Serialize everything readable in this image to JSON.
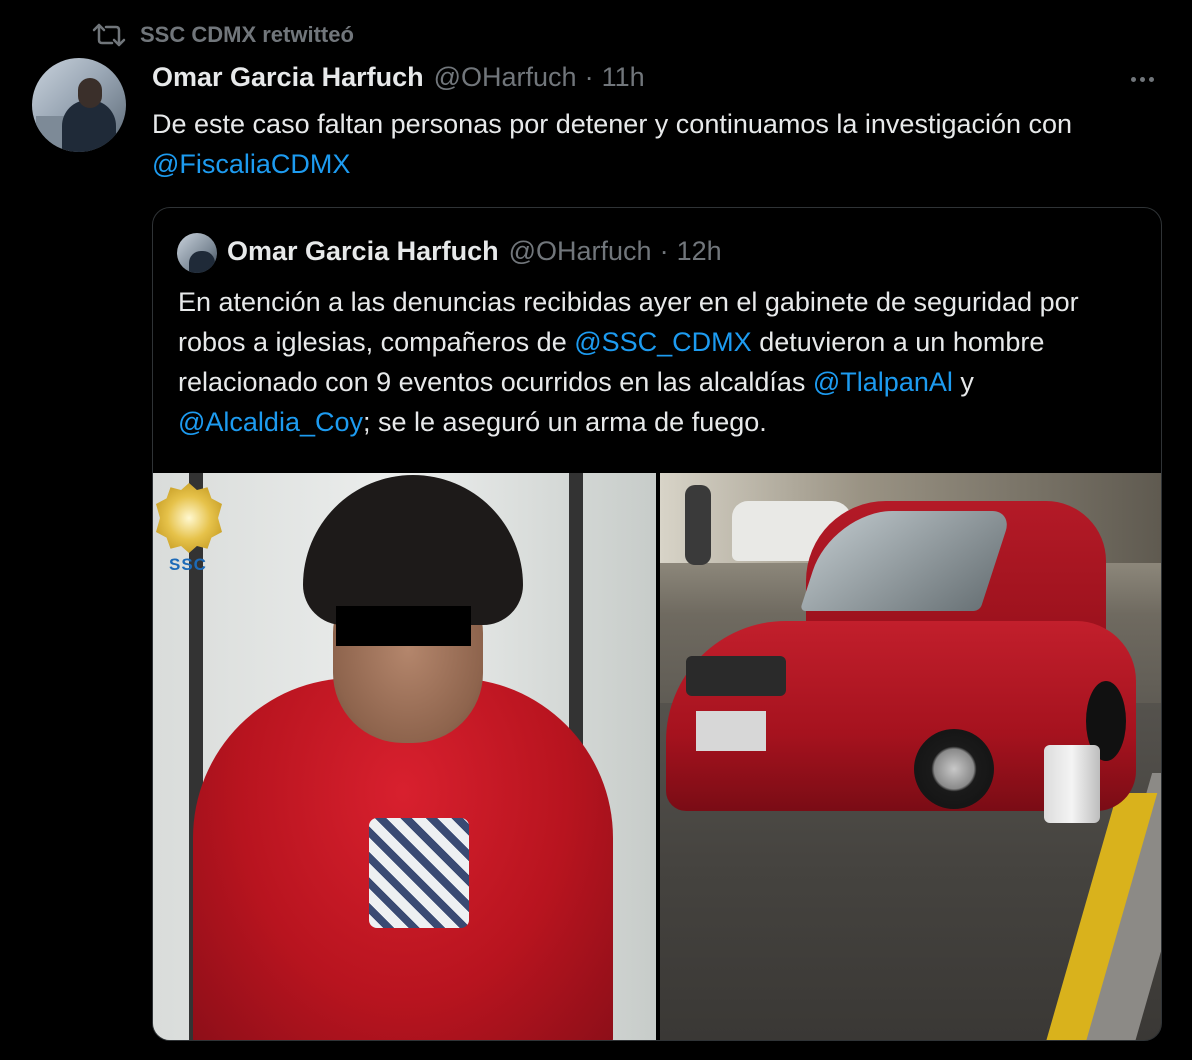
{
  "retweet": {
    "label": "SSC CDMX retwitteó",
    "icon": "retweet-icon"
  },
  "tweet": {
    "author_name": "Omar Garcia Harfuch",
    "handle": "@OHarfuch",
    "separator": "·",
    "time": "11h",
    "text_before": "De este caso faltan personas por detener y continuamos la investigación con ",
    "mention": "@FiscaliaCDMX",
    "more_icon": "more-icon"
  },
  "quote": {
    "author_name": "Omar Garcia Harfuch",
    "handle": "@OHarfuch",
    "separator": "·",
    "time": "12h",
    "text_part1": "En atención a las denuncias recibidas ayer en el gabinete de seguridad por robos a iglesias, compañeros de ",
    "mention1": "@SSC_CDMX",
    "text_part2": " detuvieron a un hombre relacionado con  9 eventos ocurridos en las alcaldías ",
    "mention2": "@TlalpanAl",
    "text_part3": " y ",
    "mention3": "@Alcaldia_Coy",
    "text_part4": "; se le aseguró un arma de fuego.",
    "photo_left_badge_text": "SSC"
  },
  "colors": {
    "background": "#000000",
    "text": "#e7e9ea",
    "secondary": "#71767b",
    "accent": "#1d9bf0",
    "border": "#2f3336"
  }
}
